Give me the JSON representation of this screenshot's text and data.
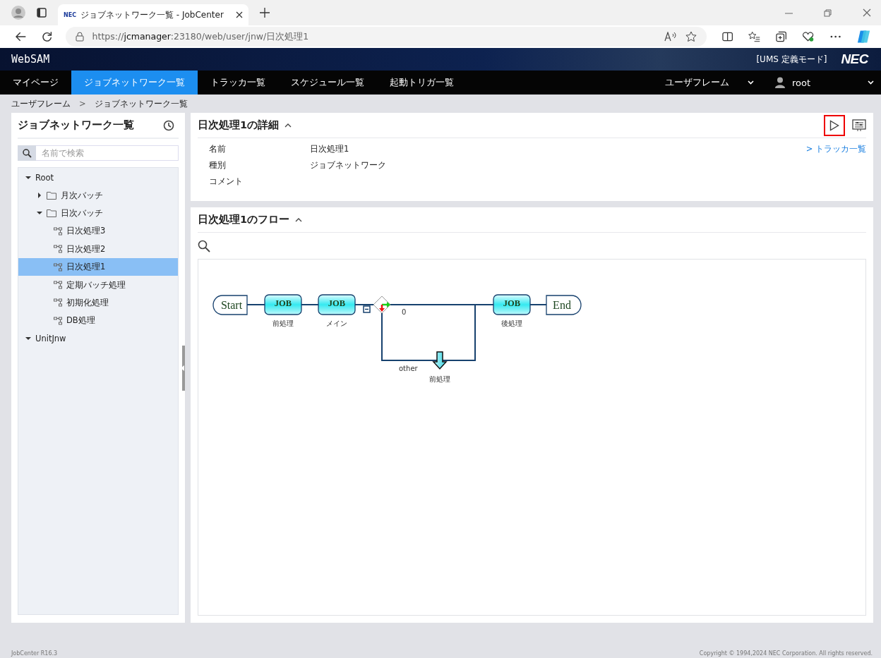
{
  "browser": {
    "tab_title": "ジョブネットワーク一覧 - JobCenter",
    "tab_favicon": "NEC",
    "url": "https://**jcmanager**:23180/web/user/jnw/日次処理1"
  },
  "header": {
    "brand": "WebSAM",
    "mode": "[UMS 定義モード]",
    "logo": "NEC"
  },
  "nav": {
    "items": [
      {
        "label": "マイページ",
        "selected": false
      },
      {
        "label": "ジョブネットワーク一覧",
        "selected": true
      },
      {
        "label": "トラッカ一覧",
        "selected": false
      },
      {
        "label": "スケジュール一覧",
        "selected": false
      },
      {
        "label": "起動トリガ一覧",
        "selected": false
      }
    ],
    "frame": "ユーザフレーム",
    "user": "root"
  },
  "breadcrumb": {
    "items": [
      "ユーザフレーム",
      "ジョブネットワーク一覧"
    ],
    "separator": ">"
  },
  "sidebar": {
    "title": "ジョブネットワーク一覧",
    "search": {
      "placeholder": "名前で検索"
    },
    "tree": [
      {
        "label": "Root",
        "kind": "root",
        "expanded": true,
        "selected": false,
        "children": [
          {
            "label": "月次バッチ",
            "kind": "folder",
            "expanded": false,
            "selected": false
          },
          {
            "label": "日次バッチ",
            "kind": "folder",
            "expanded": true,
            "selected": false,
            "children": [
              {
                "label": "日次処理3",
                "kind": "jobnet",
                "selected": false
              },
              {
                "label": "日次処理2",
                "kind": "jobnet",
                "selected": false
              },
              {
                "label": "日次処理1",
                "kind": "jobnet",
                "selected": true
              },
              {
                "label": "定期バッチ処理",
                "kind": "jobnet",
                "selected": false
              },
              {
                "label": "初期化処理",
                "kind": "jobnet",
                "selected": false
              },
              {
                "label": "DB処理",
                "kind": "jobnet",
                "selected": false
              }
            ]
          }
        ]
      },
      {
        "label": "UnitJnw",
        "kind": "root",
        "expanded": true,
        "selected": false
      }
    ]
  },
  "detail": {
    "title": "日次処理1の詳細",
    "fields": [
      {
        "label": "名前",
        "value": "日次処理1"
      },
      {
        "label": "種別",
        "value": "ジョブネットワーク"
      },
      {
        "label": "コメント"
      }
    ],
    "link": "> トラッカ一覧"
  },
  "flow": {
    "title": "日次処理1のフロー",
    "nodes": [
      {
        "kind": "start",
        "text": "Start"
      },
      {
        "kind": "job",
        "text": "JOB",
        "label": "前処理"
      },
      {
        "kind": "job",
        "text": "JOB",
        "label": "メイン"
      },
      {
        "kind": "branch",
        "label": "0",
        "label_2": "other"
      },
      {
        "kind": "ref",
        "label": "前処理"
      },
      {
        "kind": "job",
        "text": "JOB",
        "label": "後処理"
      },
      {
        "kind": "end",
        "text": "End"
      }
    ]
  },
  "footer": {
    "version": "JobCenter R16.3",
    "copyright": "Copyright © 1994,2024 NEC Corporation. All rights reserved."
  }
}
